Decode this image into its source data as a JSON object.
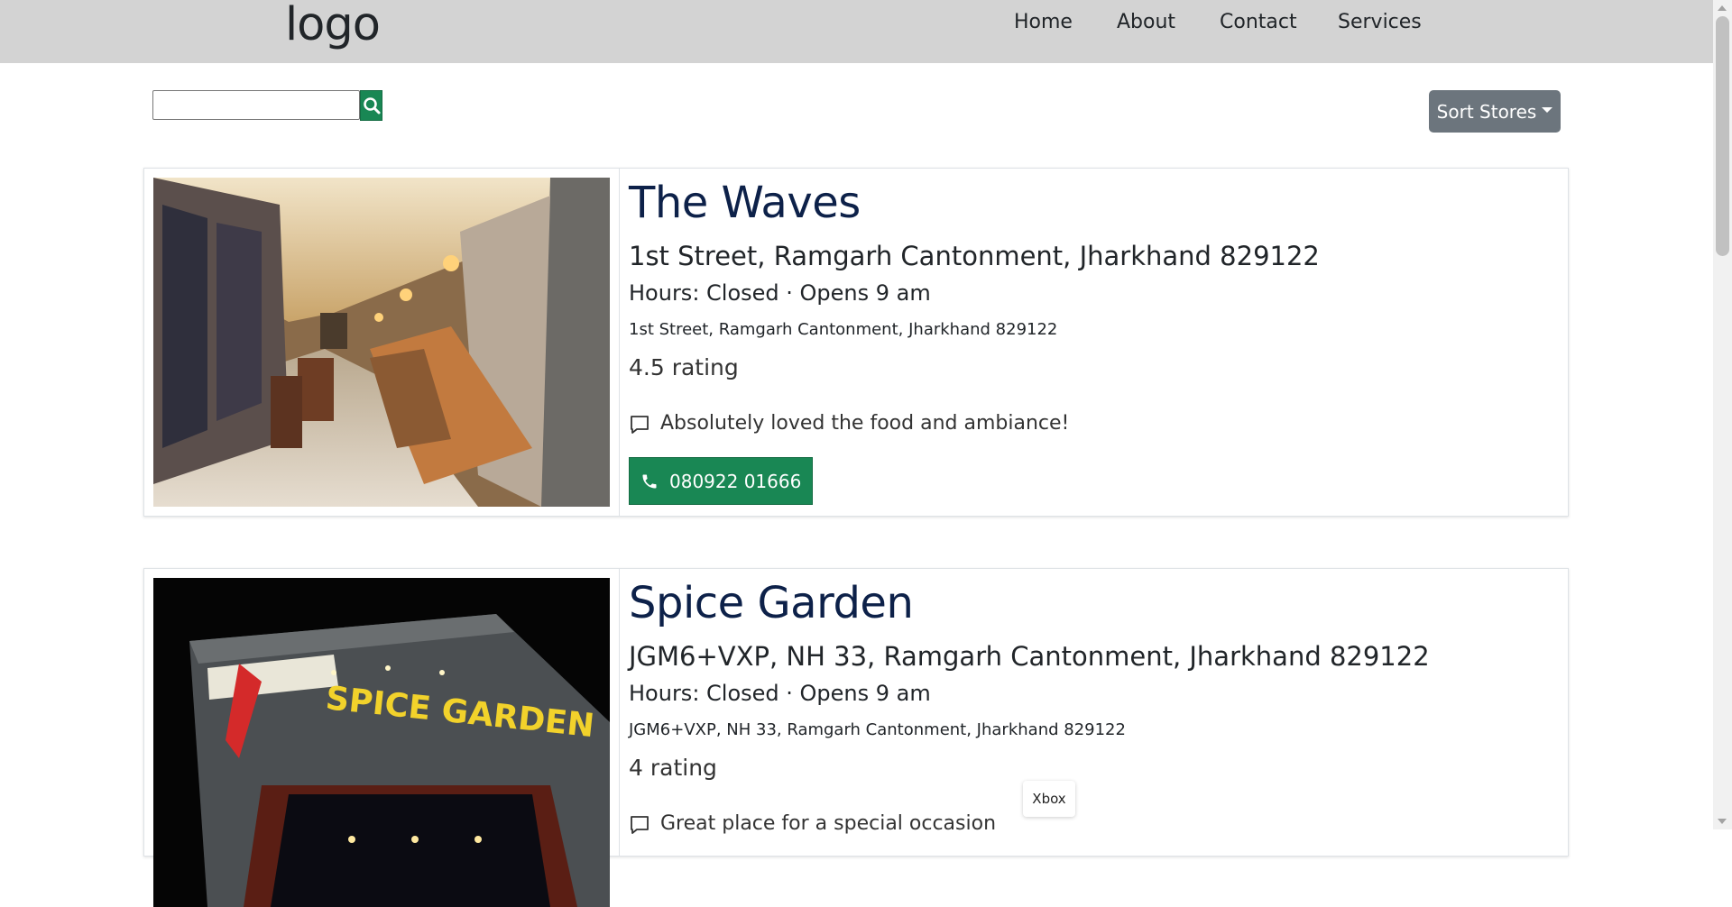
{
  "header": {
    "logo": "logo",
    "nav": [
      {
        "label": "Home"
      },
      {
        "label": "About"
      },
      {
        "label": "Contact"
      },
      {
        "label": "Services"
      }
    ]
  },
  "toolbar": {
    "search_value": "",
    "search_icon": "search-icon",
    "sort_label": "Sort Stores"
  },
  "stores": [
    {
      "name": "The Waves",
      "address_heading": "1st Street, Ramgarh Cantonment, Jharkhand 829122",
      "hours": "Hours: Closed · Opens 9 am",
      "address": "1st Street, Ramgarh Cantonment, Jharkhand 829122",
      "rating": "4.5 rating",
      "review": "Absolutely loved the food and ambiance!",
      "phone": "080922 01666"
    },
    {
      "name": "Spice Garden",
      "address_heading": "JGM6+VXP, NH 33, Ramgarh Cantonment, Jharkhand 829122",
      "hours": "Hours: Closed · Opens 9 am",
      "address": "JGM6+VXP, NH 33, Ramgarh Cantonment, Jharkhand 829122",
      "rating": "4 rating",
      "review": "Great place for a special occasion"
    }
  ],
  "tooltip": "Xbox",
  "colors": {
    "navbar": "#d3d3d3",
    "title": "#0d2149",
    "success": "#198754",
    "secondary": "#6c757d"
  }
}
